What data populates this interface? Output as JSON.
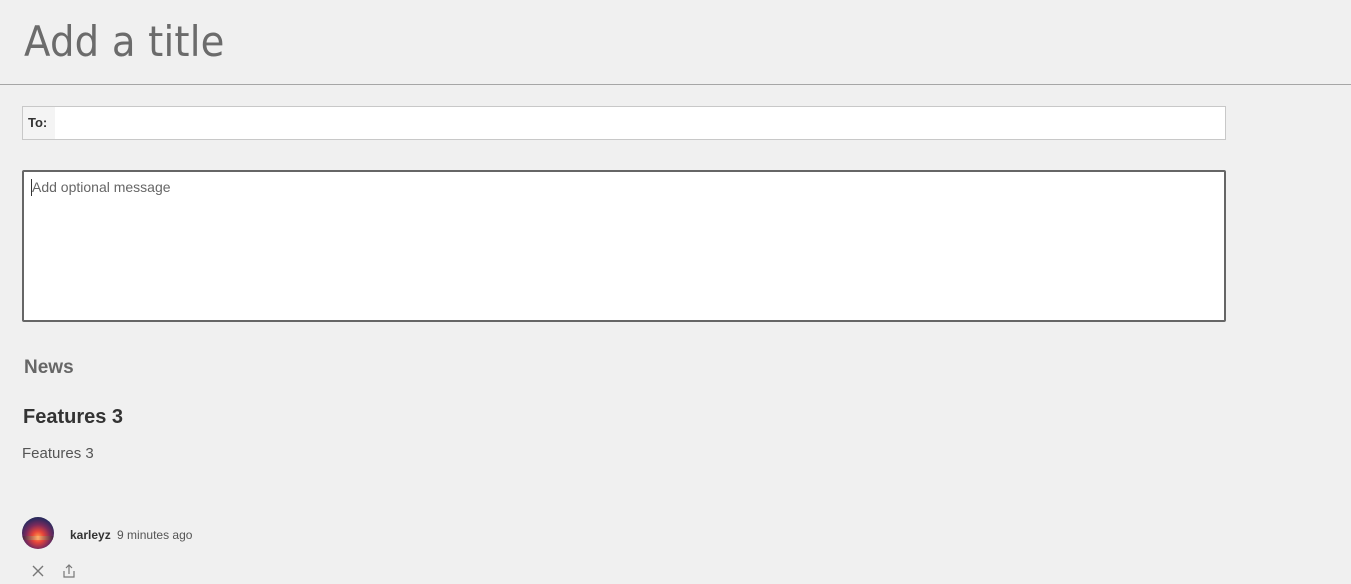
{
  "header": {
    "title_placeholder": "Add a title"
  },
  "recipients": {
    "label": "To:",
    "value": ""
  },
  "message": {
    "placeholder": "Add optional message"
  },
  "news": {
    "section_label": "News",
    "article_title": "Features 3",
    "article_description": "Features 3",
    "author": "karleyz",
    "timestamp": "9 minutes ago",
    "avatar_icon": "sunset-avatar"
  },
  "actions": {
    "icons": [
      "close-icon",
      "share-icon"
    ]
  }
}
